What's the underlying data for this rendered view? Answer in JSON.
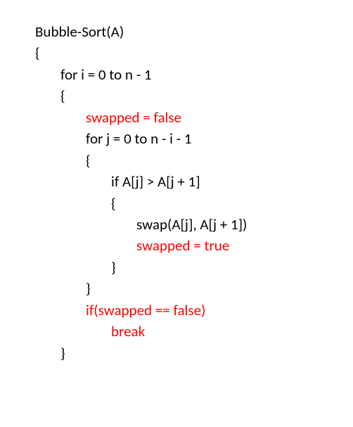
{
  "algorithm": {
    "name": "Bubble-Sort(A)",
    "open_brace": "{",
    "close_brace": "}",
    "outer_for": "for i = 0 to n - 1",
    "outer_open": "{",
    "outer_close": "}",
    "swapped_init": "swapped = false",
    "inner_for": "for j = 0 to n - i - 1",
    "inner_open": "{",
    "inner_close": "}",
    "if_cond": "if A[j] > A[j + 1]",
    "if_open": "{",
    "if_close": "}",
    "swap_call": "swap(A[j], A[j + 1])",
    "swapped_set": "swapped = true",
    "break_cond": "if(swapped == false)",
    "break_stmt": "break"
  }
}
